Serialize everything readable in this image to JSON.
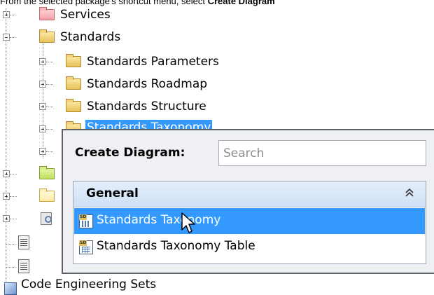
{
  "caption": {
    "prefix": "From the selected package's shortcut menu, select ",
    "bold": "Create Diagram"
  },
  "tree": {
    "services": "Services",
    "standards": "Standards",
    "standards_parameters": "Standards Parameters",
    "standards_roadmap": "Standards Roadmap",
    "standards_structure": "Standards Structure",
    "standards_taxonomy": "Standards Taxonomy",
    "code_engineering_sets": "Code Engineering Sets"
  },
  "popup": {
    "title": "Create Diagram:",
    "search_placeholder": "Search",
    "search_value": "",
    "group": "General",
    "collapse_glyph": "⌃",
    "items": [
      {
        "label": "Standards Taxonomy",
        "selected": true
      },
      {
        "label": "Standards Taxonomy Table",
        "selected": false
      }
    ]
  },
  "colors": {
    "selection": "#3399ff",
    "group_header": "#d9e6f7",
    "popup_bg": "#eef0f3"
  },
  "icons": {
    "expand": "plus-box",
    "collapse": "minus-box",
    "folder": "folder-icon",
    "diagram": "diagram-icon",
    "table": "table-icon",
    "cursor": "mouse-pointer"
  }
}
